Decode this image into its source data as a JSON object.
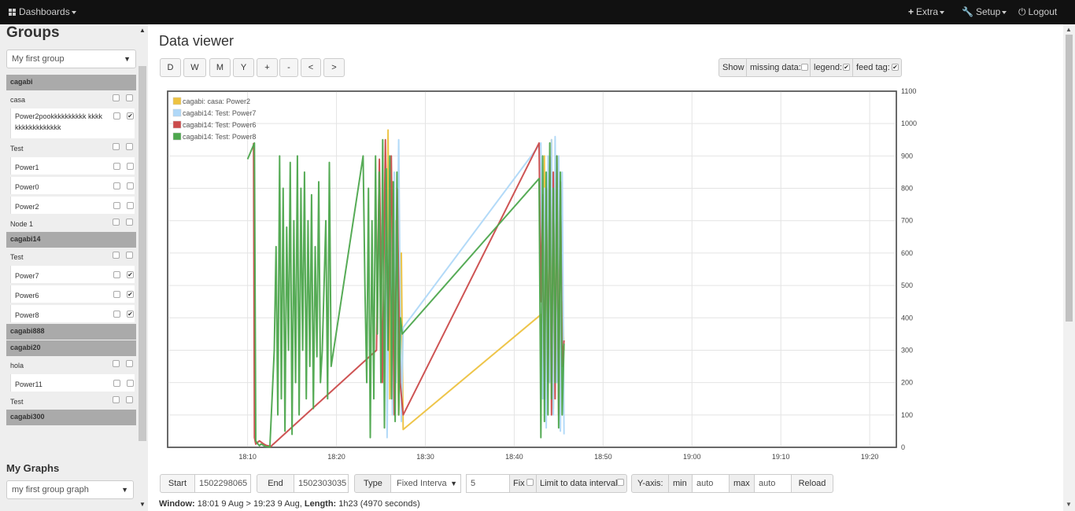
{
  "nav": {
    "dashboards": "Dashboards",
    "extra": "Extra",
    "setup": "Setup",
    "logout": "Logout"
  },
  "sidebar": {
    "groups_title": "Groups",
    "group_select": "My first group",
    "graphs_title": "My Graphs",
    "graph_select": "my first group graph",
    "tree": [
      {
        "kind": "user",
        "label": "cagabi"
      },
      {
        "kind": "node",
        "label": "casa"
      },
      {
        "kind": "feed",
        "label": "Power2pookkkkkkkkkk kkkkkkkkkkkkkkkkk",
        "checked": true,
        "tall": true
      },
      {
        "kind": "node",
        "label": "Test"
      },
      {
        "kind": "feed",
        "label": "Power1",
        "checked": false
      },
      {
        "kind": "feed",
        "label": "Power0",
        "checked": false
      },
      {
        "kind": "feed",
        "label": "Power2",
        "checked": false
      },
      {
        "kind": "node",
        "label": "Node 1"
      },
      {
        "kind": "user",
        "label": "cagabi14"
      },
      {
        "kind": "node",
        "label": "Test"
      },
      {
        "kind": "feed",
        "label": "Power7",
        "checked": true
      },
      {
        "kind": "feed",
        "label": "Power6",
        "checked": true
      },
      {
        "kind": "feed",
        "label": "Power8",
        "checked": true
      },
      {
        "kind": "user",
        "label": "cagabi888"
      },
      {
        "kind": "user",
        "label": "cagabi20"
      },
      {
        "kind": "node",
        "label": "hola"
      },
      {
        "kind": "feed",
        "label": "Power11",
        "checked": false
      },
      {
        "kind": "node",
        "label": "Test"
      },
      {
        "kind": "user",
        "label": "cagabi300"
      }
    ]
  },
  "viewer": {
    "title": "Data viewer",
    "range_buttons": [
      "D",
      "W",
      "M",
      "Y",
      "+",
      "-",
      "<",
      ">"
    ],
    "show_label": "Show",
    "missing_data_label": "missing data:",
    "missing_data_checked": false,
    "legend_label": "legend:",
    "legend_checked": true,
    "feed_tag_label": "feed tag:",
    "feed_tag_checked": true
  },
  "controls": {
    "start_label": "Start",
    "start_value": "1502298065",
    "end_label": "End",
    "end_value": "1502303035",
    "type_label": "Type",
    "type_value": "Fixed Interva",
    "interval_value": "5",
    "fix_label": "Fix",
    "limit_label": "Limit to data interval",
    "yaxis_label": "Y-axis:",
    "min_label": "min",
    "min_value": "auto",
    "max_label": "max",
    "max_value": "auto",
    "reload_label": "Reload"
  },
  "window_info": {
    "window_label": "Window:",
    "window_value": "18:01 9 Aug > 19:23 9 Aug,",
    "length_label": "Length:",
    "length_value": "1h23 (4970 seconds)"
  },
  "chart_data": {
    "type": "line",
    "x_unit": "time (HH:MM, 9 Aug)",
    "xlim": [
      "18:01",
      "19:23"
    ],
    "xticks": [
      "18:10",
      "18:20",
      "18:30",
      "18:40",
      "18:50",
      "19:00",
      "19:10",
      "19:20"
    ],
    "ylim": [
      0,
      1100
    ],
    "yticks": [
      0,
      100,
      200,
      300,
      400,
      500,
      600,
      700,
      800,
      900,
      1000,
      1100
    ],
    "grid": true,
    "legend_position": "top-left",
    "series": [
      {
        "name": "cagabi: casa: Power2",
        "color": "#edc240",
        "x": [
          "18:25:42",
          "18:25:48",
          "18:26:00",
          "18:26:18",
          "18:26:30",
          "18:26:42",
          "18:27:00",
          "18:27:18",
          "18:27:30",
          "18:43:00",
          "18:43:12",
          "18:43:24",
          "18:43:36",
          "18:43:48",
          "18:44:00",
          "18:44:12",
          "18:44:24",
          "18:44:36",
          "18:44:48",
          "18:45:00",
          "18:45:12",
          "18:45:24",
          "18:45:36"
        ],
        "y": [
          600,
          980,
          150,
          820,
          300,
          700,
          100,
          600,
          55,
          410,
          300,
          900,
          150,
          800,
          200,
          950,
          120,
          700,
          300,
          850,
          100,
          450,
          300
        ]
      },
      {
        "name": "cagabi14: Test: Power7",
        "color": "#afd8f8",
        "x": [
          "18:25:30",
          "18:25:42",
          "18:26:00",
          "18:26:18",
          "18:26:30",
          "18:26:42",
          "18:27:00",
          "18:27:18",
          "18:27:30",
          "18:43:00",
          "18:43:12",
          "18:43:24",
          "18:43:36",
          "18:43:48",
          "18:44:00",
          "18:44:12",
          "18:44:24",
          "18:44:36",
          "18:44:48",
          "18:45:00",
          "18:45:12",
          "18:45:24",
          "18:45:36"
        ],
        "y": [
          870,
          30,
          900,
          100,
          850,
          200,
          950,
          80,
          370,
          940,
          150,
          800,
          60,
          900,
          200,
          950,
          100,
          960,
          200,
          900,
          50,
          850,
          40
        ]
      },
      {
        "name": "cagabi14: Test: Power6",
        "color": "#cb4b4b",
        "x": [
          "18:10:40",
          "18:10:46",
          "18:10:55",
          "18:11:20",
          "18:11:50",
          "18:12:10",
          "18:12:20",
          "18:12:30",
          "18:24:30",
          "18:24:50",
          "18:25:10",
          "18:25:30",
          "18:25:50",
          "18:26:10",
          "18:26:30",
          "18:26:50",
          "18:27:10",
          "18:27:30",
          "18:42:48",
          "18:43:00",
          "18:43:12",
          "18:43:24",
          "18:43:36",
          "18:43:48",
          "18:44:00",
          "18:44:12",
          "18:44:24",
          "18:44:36",
          "18:44:48",
          "18:45:00",
          "18:45:12",
          "18:45:24",
          "18:45:36"
        ],
        "y": [
          940,
          30,
          10,
          20,
          10,
          5,
          5,
          0,
          300,
          890,
          200,
          950,
          300,
          900,
          100,
          800,
          200,
          100,
          940,
          450,
          780,
          150,
          800,
          200,
          900,
          100,
          850,
          150,
          900,
          100,
          820,
          250,
          330
        ]
      },
      {
        "name": "cagabi14: Test: Power8",
        "color": "#4da74d",
        "x": [
          "18:10:00",
          "18:10:46",
          "18:10:55",
          "18:11:10",
          "18:11:20",
          "18:11:30",
          "18:11:40",
          "18:11:50",
          "18:12:00",
          "18:12:10",
          "18:12:20",
          "18:12:30",
          "18:13:00",
          "18:13:12",
          "18:13:24",
          "18:13:36",
          "18:13:48",
          "18:14:00",
          "18:14:12",
          "18:14:24",
          "18:14:36",
          "18:14:48",
          "18:15:00",
          "18:15:12",
          "18:15:24",
          "18:15:36",
          "18:15:48",
          "18:16:00",
          "18:16:12",
          "18:16:24",
          "18:16:36",
          "18:16:48",
          "18:17:00",
          "18:17:12",
          "18:17:24",
          "18:17:36",
          "18:17:48",
          "18:18:00",
          "18:18:12",
          "18:18:24",
          "18:18:36",
          "18:18:48",
          "18:19:00",
          "18:19:12",
          "18:19:24",
          "18:23:00",
          "18:23:12",
          "18:23:24",
          "18:23:36",
          "18:23:48",
          "18:24:00",
          "18:24:12",
          "18:24:24",
          "18:24:36",
          "18:24:48",
          "18:25:00",
          "18:25:12",
          "18:25:24",
          "18:25:36",
          "18:25:48",
          "18:26:00",
          "18:26:12",
          "18:26:24",
          "18:26:36",
          "18:26:48",
          "18:27:00",
          "18:27:12",
          "18:27:24",
          "18:42:48",
          "18:43:00",
          "18:43:12",
          "18:43:24",
          "18:43:36",
          "18:43:48",
          "18:44:00",
          "18:44:12",
          "18:44:24",
          "18:44:36",
          "18:44:48",
          "18:45:00",
          "18:45:12",
          "18:45:24",
          "18:45:36"
        ],
        "y": [
          890,
          940,
          20,
          10,
          5,
          10,
          8,
          5,
          3,
          2,
          2,
          0,
          300,
          620,
          100,
          900,
          150,
          800,
          50,
          680,
          300,
          880,
          40,
          700,
          200,
          900,
          100,
          800,
          300,
          850,
          150,
          700,
          250,
          780,
          120,
          620,
          280,
          820,
          200,
          300,
          500,
          700,
          150,
          880,
          250,
          900,
          500,
          200,
          800,
          30,
          700,
          150,
          900,
          350,
          850,
          200,
          950,
          60,
          860,
          300,
          900,
          150,
          820,
          80,
          850,
          100,
          400,
          350,
          830,
          30,
          900,
          80,
          850,
          100,
          940,
          150,
          800,
          200,
          900,
          60,
          850,
          100,
          320
        ]
      }
    ]
  }
}
